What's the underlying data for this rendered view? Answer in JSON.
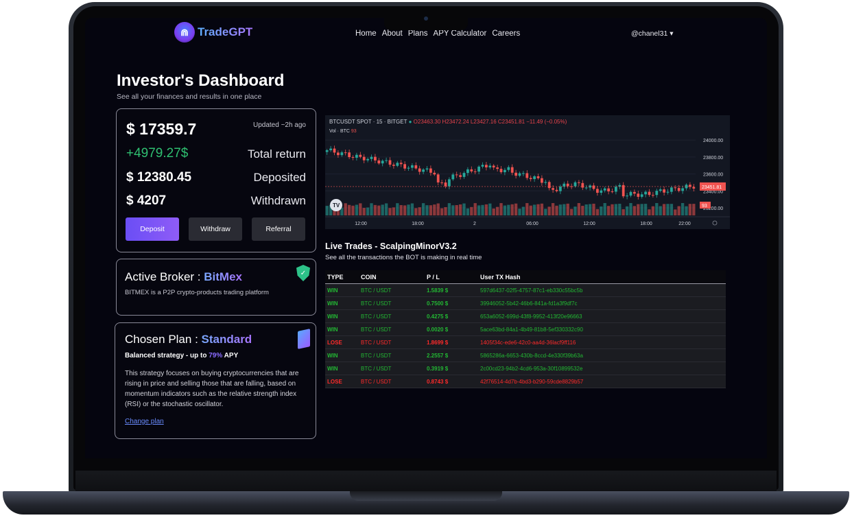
{
  "brand": {
    "name": "TradeGPT"
  },
  "nav": {
    "items": [
      "Home",
      "About",
      "Plans",
      "APY Calculator",
      "Careers"
    ],
    "user": "@chanel31 ▾"
  },
  "page": {
    "title": "Investor's Dashboard",
    "subtitle": "See all your finances and results in one place"
  },
  "summary": {
    "balance": "$ 17359.7",
    "updated": "Updated ~2h ago",
    "total_return_value": "+4979.27$",
    "total_return_label": "Total return",
    "deposited_value": "$ 12380.45",
    "deposited_label": "Deposited",
    "withdrawn_value": "$ 4207",
    "withdrawn_label": "Withdrawn",
    "deposit_btn": "Deposit",
    "withdraw_btn": "Withdraw",
    "referral_btn": "Referral"
  },
  "broker": {
    "label": "Active Broker : ",
    "name": "BitMex",
    "desc": "BITMEX is a P2P crypto-products trading platform"
  },
  "plan": {
    "label": "Chosen Plan : ",
    "name": "Standard",
    "tag_prefix": "Balanced strategy - up to ",
    "apy": "79%",
    "tag_suffix": " APY",
    "desc": "This strategy focuses on buying cryptocurrencies that are rising in price and selling those that are falling, based on momentum indicators such as the relative strength index (RSI) or the stochastic oscillator.",
    "change": "Change plan"
  },
  "chart": {
    "symbol": "BTCUSDT SPOT · 15 · BITGET",
    "ohlc": "O23463.30 H23472.24 L23427.16 C23451.81 −11.49 (−0.05%)",
    "vol_label": "Vol · BTC",
    "vol_value": "93",
    "last_price": "23451.81",
    "vol_marker": "93",
    "y_ticks": [
      "24000.00",
      "23800.00",
      "23600.00",
      "23400.00",
      "23200.00"
    ],
    "x_ticks": [
      "12:00",
      "18:00",
      "2",
      "06:00",
      "12:00",
      "18:00",
      "22:00"
    ],
    "colors": {
      "up": "#26a69a",
      "down": "#ef5350"
    }
  },
  "trades": {
    "title": "Live Trades - ScalpingMinorV3.2",
    "subtitle": "See all the transactions the BOT is making in real time",
    "headers": [
      "TYPE",
      "COIN",
      "P / L",
      "User TX Hash"
    ],
    "rows": [
      {
        "type": "WIN",
        "coin": "BTC / USDT",
        "pl": "1.5839 $",
        "hash": "597d6437-02f5-4757-87c1-eb330c55bc5b"
      },
      {
        "type": "WIN",
        "coin": "BTC / USDT",
        "pl": "0.7500 $",
        "hash": "39946052-5b42-46b6-841a-fd1a3f9df7c"
      },
      {
        "type": "WIN",
        "coin": "BTC / USDT",
        "pl": "0.4275 $",
        "hash": "653a6052-699d-43f8-9952-413f20e96663"
      },
      {
        "type": "WIN",
        "coin": "BTC / USDT",
        "pl": "0.0020 $",
        "hash": "5ace63bd-84a1-4b49-81b8-5ef330332c90"
      },
      {
        "type": "LOSE",
        "coin": "BTC / USDT",
        "pl": "1.8699 $",
        "hash": "1405f34c-ede6-42c0-aa4d-36lacf9ff116"
      },
      {
        "type": "WIN",
        "coin": "BTC / USDT",
        "pl": "2.2557 $",
        "hash": "5865286a-6653-430b-8ccd-4e330f39b63a"
      },
      {
        "type": "WIN",
        "coin": "BTC / USDT",
        "pl": "0.3919 $",
        "hash": "2c00cd23-94b2-4cd6-953a-30f10899532e"
      },
      {
        "type": "LOSE",
        "coin": "BTC / USDT",
        "pl": "0.8743 $",
        "hash": "42f76514-4d7b-4bd3-b290-59cde8829b57"
      }
    ]
  }
}
